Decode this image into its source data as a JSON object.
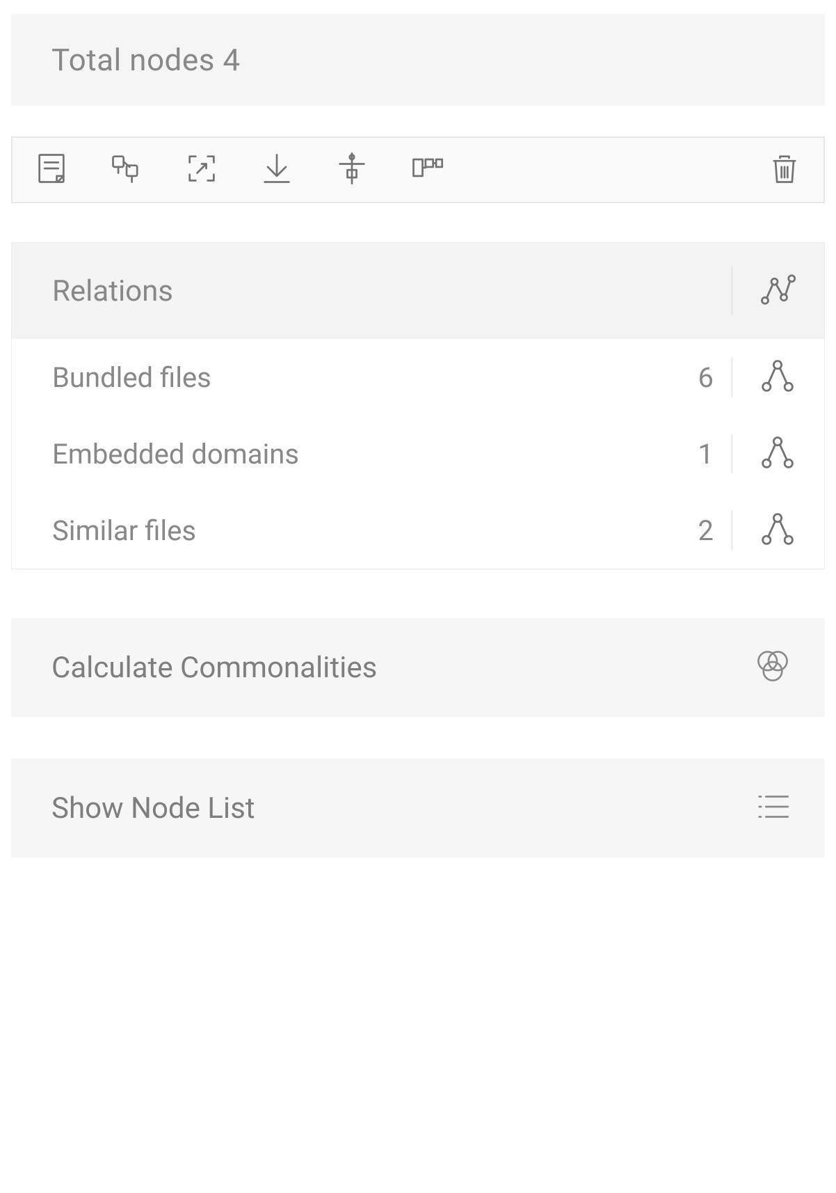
{
  "header": {
    "title": "Total nodes 4"
  },
  "toolbar": {
    "note_icon": "note",
    "pin_icon": "pin",
    "expand_icon": "expand",
    "download_icon": "download",
    "balance_icon": "balance",
    "layout_icon": "layout",
    "trash_icon": "trash"
  },
  "relations": {
    "title": "Relations",
    "items": [
      {
        "label": "Bundled files",
        "count": "6"
      },
      {
        "label": "Embedded domains",
        "count": "1"
      },
      {
        "label": "Similar files",
        "count": "2"
      }
    ]
  },
  "actions": {
    "commonalities": "Calculate Commonalities",
    "node_list": "Show Node List"
  }
}
